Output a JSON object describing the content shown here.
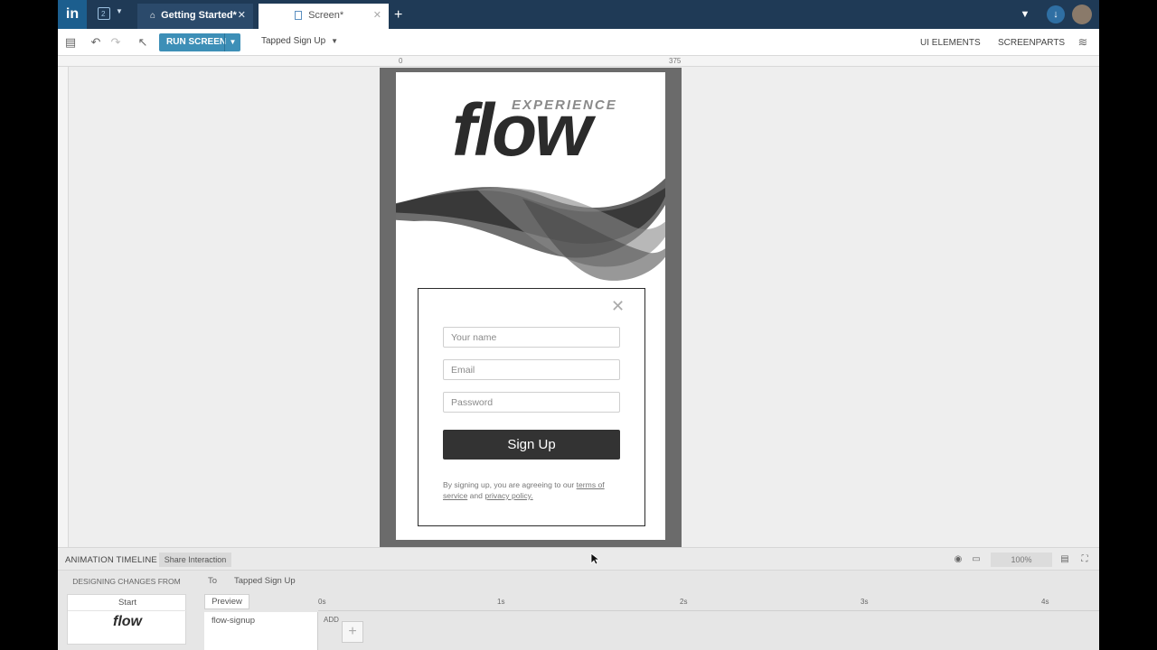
{
  "titlebar": {
    "tabs": [
      {
        "label": "Getting Started*",
        "icon": "home-icon"
      },
      {
        "label": "Screen*",
        "icon": "page-icon"
      }
    ],
    "project_count": "2"
  },
  "toolbar": {
    "run_label": "RUN SCREEN",
    "scenario": "Tapped Sign Up",
    "ui_elements": "UI ELEMENTS",
    "screenparts": "SCREENPARTS"
  },
  "rulers": {
    "start": "0",
    "end": "375"
  },
  "screen": {
    "brand_small": "EXPERIENCE",
    "brand_large": "flow",
    "modal": {
      "name_placeholder": "Your name",
      "email_placeholder": "Email",
      "password_placeholder": "Password",
      "button": "Sign Up",
      "legal_prefix": "By signing up, you are agreeing to our",
      "legal_terms_a": "terms of",
      "legal_terms_b": "service",
      "legal_and": "and",
      "legal_privacy": "privacy policy."
    }
  },
  "animbar": {
    "title": "ANIMATION TIMELINE",
    "share": "Share Interaction",
    "zoom": "100%"
  },
  "timeline": {
    "designing_from": "DESIGNING CHANGES FROM",
    "to_label": "To",
    "to_name": "Tapped Sign Up",
    "start_label": "Start",
    "start_thumb": "flow",
    "preview": "Preview",
    "layer": "flow-signup",
    "add_label": "ADD",
    "ticks": [
      "0s",
      "1s",
      "2s",
      "3s",
      "4s"
    ]
  },
  "colors": {
    "titlebar": "#1f3a56",
    "accent": "#3d8fb7",
    "button_dark": "#333333"
  }
}
